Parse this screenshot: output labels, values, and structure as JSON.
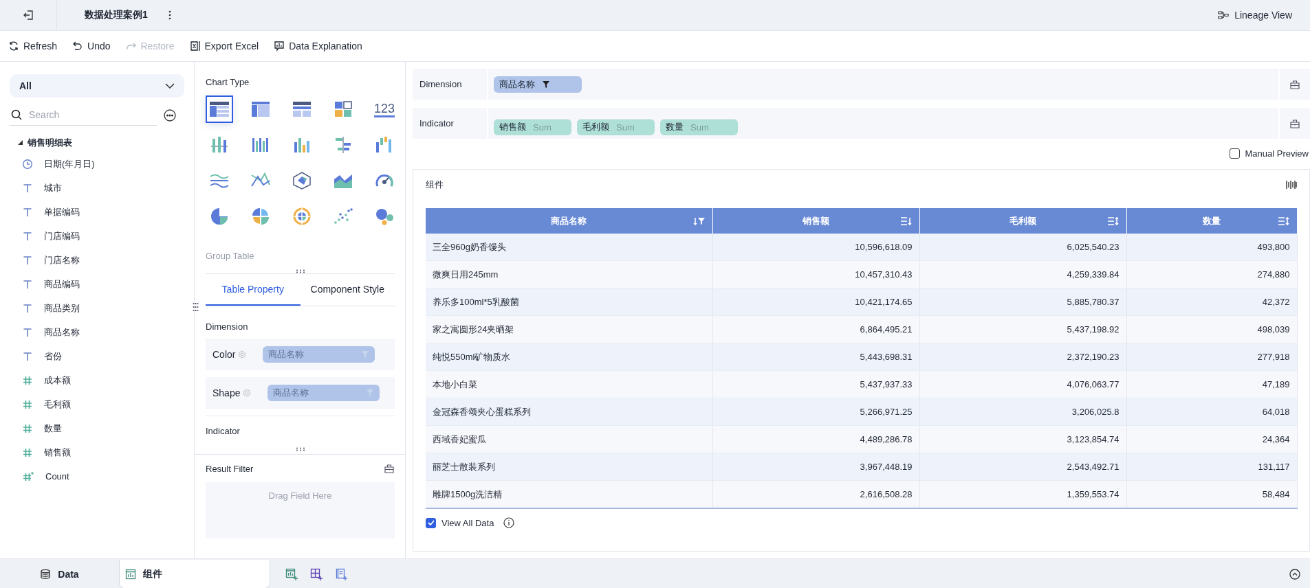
{
  "header": {
    "title": "数据处理案例1",
    "lineage": "Lineage View"
  },
  "toolbar": [
    {
      "label": "Refresh",
      "kind": "refresh",
      "disabled": false
    },
    {
      "label": "Undo",
      "kind": "undo",
      "disabled": false
    },
    {
      "label": "Restore",
      "kind": "redo",
      "disabled": true
    },
    {
      "label": "Export Excel",
      "kind": "excel",
      "disabled": false
    },
    {
      "label": "Data Explanation",
      "kind": "explain",
      "disabled": false
    }
  ],
  "fields_panel": {
    "scope": "All",
    "search_placeholder": "Search",
    "tree": [
      {
        "label": "销售明细表",
        "expanded": true,
        "children": [
          {
            "label": "日期(年月日)",
            "kind": "date"
          },
          {
            "label": "城市",
            "kind": "text"
          },
          {
            "label": "单据编码",
            "kind": "text"
          },
          {
            "label": "门店编码",
            "kind": "text"
          },
          {
            "label": "门店名称",
            "kind": "text"
          },
          {
            "label": "商品编码",
            "kind": "text"
          },
          {
            "label": "商品类别",
            "kind": "text"
          },
          {
            "label": "商品名称",
            "kind": "text"
          },
          {
            "label": "省份",
            "kind": "text"
          },
          {
            "label": "成本额",
            "kind": "number"
          },
          {
            "label": "毛利额",
            "kind": "number"
          },
          {
            "label": "数量",
            "kind": "number"
          },
          {
            "label": "销售额",
            "kind": "number"
          },
          {
            "label": "Count",
            "kind": "count"
          }
        ]
      }
    ]
  },
  "config_panel": {
    "title": "Chart Type",
    "chart_types": [
      {
        "kind": "group_table",
        "selected": true
      },
      {
        "kind": "cross_table",
        "selected": false
      },
      {
        "kind": "detail_table",
        "selected": false
      },
      {
        "kind": "kpi",
        "selected": false
      },
      {
        "kind": "number",
        "label": "123",
        "selected": false
      },
      {
        "kind": "stack_bar",
        "selected": false
      },
      {
        "kind": "multi_bar",
        "selected": false
      },
      {
        "kind": "column",
        "selected": false
      },
      {
        "kind": "hbar",
        "selected": false
      },
      {
        "kind": "waterfall",
        "selected": false
      },
      {
        "kind": "wave",
        "selected": false
      },
      {
        "kind": "cross_line",
        "selected": false
      },
      {
        "kind": "radar",
        "selected": false
      },
      {
        "kind": "area",
        "selected": false
      },
      {
        "kind": "gauge",
        "selected": false
      },
      {
        "kind": "pie",
        "selected": false
      },
      {
        "kind": "rose",
        "selected": false
      },
      {
        "kind": "sunburst",
        "selected": false
      },
      {
        "kind": "scatter",
        "selected": false
      },
      {
        "kind": "bubble",
        "selected": false
      }
    ],
    "chart_name": "Group Table",
    "tabs": [
      {
        "label": "Table Property",
        "selected": true
      },
      {
        "label": "Component Style",
        "selected": false
      }
    ],
    "dimension_title": "Dimension",
    "dimension_props": [
      {
        "label": "Color",
        "field": "商品名称"
      },
      {
        "label": "Shape",
        "field": "商品名称"
      }
    ],
    "indicator_title": "Indicator",
    "result_filter": {
      "title": "Result Filter",
      "drop_hint": "Drag Field Here"
    }
  },
  "shelves": [
    {
      "label": "Dimension",
      "kind": "dimension",
      "fields": [
        {
          "name": "商品名称"
        }
      ]
    },
    {
      "label": "Indicator",
      "kind": "indicator",
      "fields": [
        {
          "name": "销售额",
          "agg": "Sum"
        },
        {
          "name": "毛利额",
          "agg": "Sum"
        },
        {
          "name": "数量",
          "agg": "Sum"
        }
      ]
    }
  ],
  "manual_preview": {
    "label": "Manual Preview",
    "checked": false
  },
  "component": {
    "title": "组件",
    "table": {
      "columns": [
        {
          "label": "商品名称",
          "kind": "sorted_filtered"
        },
        {
          "label": "销售额",
          "kind": "sorted"
        },
        {
          "label": "毛利额",
          "kind": "sortable"
        },
        {
          "label": "数量",
          "kind": "sortable"
        }
      ],
      "rows": [
        [
          "三全960g奶香馒头",
          "10,596,618.09",
          "6,025,540.23",
          "493,800"
        ],
        [
          "微爽日用245mm",
          "10,457,310.43",
          "4,259,339.84",
          "274,880"
        ],
        [
          "养乐多100ml*5乳酸菌",
          "10,421,174.65",
          "5,885,780.37",
          "42,372"
        ],
        [
          "家之寓圆形24夹晒架",
          "6,864,495.21",
          "5,437,198.92",
          "498,039"
        ],
        [
          "纯悦550ml矿物质水",
          "5,443,698.31",
          "2,372,190.23",
          "277,918"
        ],
        [
          "本地小白菜",
          "5,437,937.33",
          "4,076,063.77",
          "47,189"
        ],
        [
          "金冠森香颂夹心蛋糕系列",
          "5,266,971.25",
          "3,206,025.8",
          "64,018"
        ],
        [
          "西域香妃蜜瓜",
          "4,489,286.78",
          "3,123,854.74",
          "24,364"
        ],
        [
          "丽芝士散装系列",
          "3,967,448.19",
          "2,543,492.71",
          "131,117"
        ],
        [
          "雕牌1500g洗洁精",
          "2,616,508.28",
          "1,359,553.74",
          "58,484"
        ]
      ]
    },
    "view_all": {
      "label": "View All Data",
      "checked": true
    }
  },
  "bottom_tabs": [
    {
      "label": "Data",
      "kind": "data",
      "selected": false
    },
    {
      "label": "组件",
      "kind": "component",
      "selected": true
    }
  ]
}
